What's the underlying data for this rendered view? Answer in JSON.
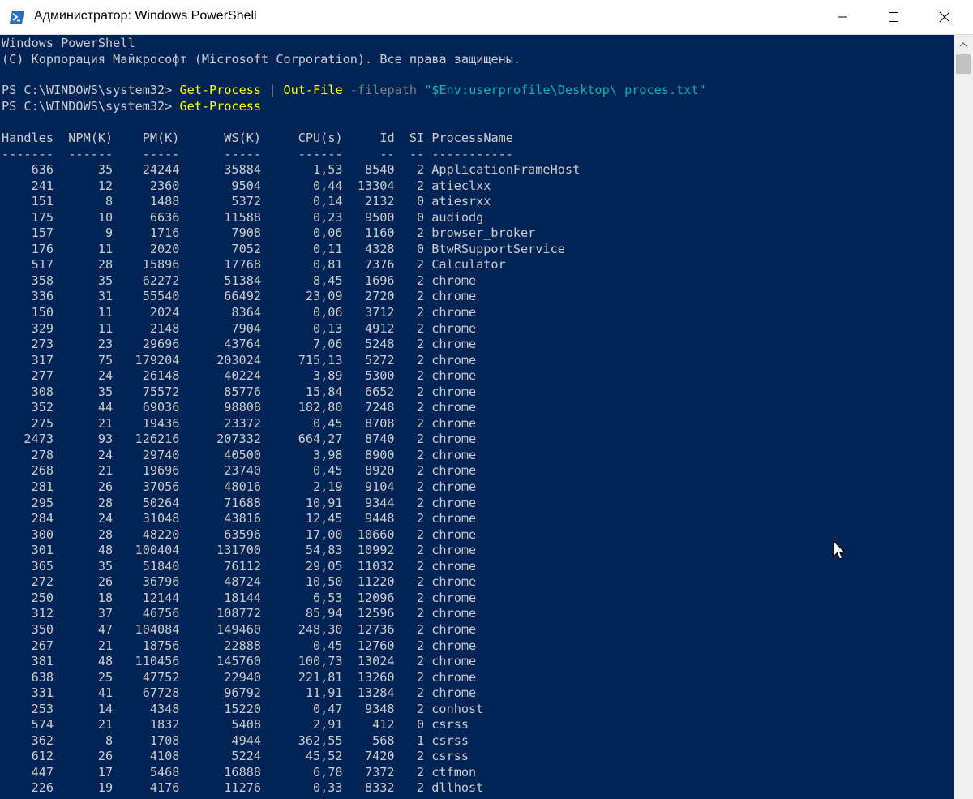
{
  "window": {
    "title": "Администратор: Windows PowerShell",
    "controls": [
      "minimize-icon",
      "maximize-icon",
      "close-icon"
    ],
    "colors": {
      "background": "#012456",
      "text": "#cccccc",
      "command": "#ffff00",
      "parameter": "#808080",
      "string": "#00b4b4"
    }
  },
  "console": {
    "header_line1": "Windows PowerShell",
    "header_line2": "(C) Корпорация Майкрософт (Microsoft Corporation). Все права защищены.",
    "cmd1": {
      "prompt": "PS C:\\WINDOWS\\system32> ",
      "command": "Get-Process",
      "pipe": " | ",
      "command2": "Out-File",
      "param": " -filepath ",
      "path": "\"$Env:userprofile\\Desktop\\ proces.txt\""
    },
    "cmd2": {
      "prompt": "PS C:\\WINDOWS\\system32> ",
      "command": "Get-Process"
    },
    "table_header": "Handles  NPM(K)    PM(K)      WS(K)     CPU(s)     Id  SI ProcessName",
    "table_separator": "-------  ------    -----      -----     ------     --  -- -----------",
    "rows": [
      [
        "636",
        "35",
        "24244",
        "35884",
        "1,53",
        "8540",
        "2",
        "ApplicationFrameHost"
      ],
      [
        "241",
        "12",
        "2360",
        "9504",
        "0,44",
        "13304",
        "2",
        "atieclxx"
      ],
      [
        "151",
        "8",
        "1488",
        "5372",
        "0,14",
        "2132",
        "0",
        "atiesrxx"
      ],
      [
        "175",
        "10",
        "6636",
        "11588",
        "0,23",
        "9500",
        "0",
        "audiodg"
      ],
      [
        "157",
        "9",
        "1716",
        "7908",
        "0,06",
        "1160",
        "2",
        "browser_broker"
      ],
      [
        "176",
        "11",
        "2020",
        "7052",
        "0,11",
        "4328",
        "0",
        "BtwRSupportService"
      ],
      [
        "517",
        "28",
        "15896",
        "17768",
        "0,81",
        "7376",
        "2",
        "Calculator"
      ],
      [
        "358",
        "35",
        "62272",
        "51384",
        "8,45",
        "1696",
        "2",
        "chrome"
      ],
      [
        "336",
        "31",
        "55540",
        "66492",
        "23,09",
        "2720",
        "2",
        "chrome"
      ],
      [
        "150",
        "11",
        "2024",
        "8364",
        "0,06",
        "3712",
        "2",
        "chrome"
      ],
      [
        "329",
        "11",
        "2148",
        "7904",
        "0,13",
        "4912",
        "2",
        "chrome"
      ],
      [
        "273",
        "23",
        "29696",
        "43764",
        "7,06",
        "5248",
        "2",
        "chrome"
      ],
      [
        "317",
        "75",
        "179204",
        "203024",
        "715,13",
        "5272",
        "2",
        "chrome"
      ],
      [
        "277",
        "24",
        "26148",
        "40224",
        "3,89",
        "5300",
        "2",
        "chrome"
      ],
      [
        "308",
        "35",
        "75572",
        "85776",
        "15,84",
        "6652",
        "2",
        "chrome"
      ],
      [
        "352",
        "44",
        "69036",
        "98808",
        "182,80",
        "7248",
        "2",
        "chrome"
      ],
      [
        "275",
        "21",
        "19436",
        "23372",
        "0,45",
        "8708",
        "2",
        "chrome"
      ],
      [
        "2473",
        "93",
        "126216",
        "207332",
        "664,27",
        "8740",
        "2",
        "chrome"
      ],
      [
        "278",
        "24",
        "29740",
        "40500",
        "3,98",
        "8900",
        "2",
        "chrome"
      ],
      [
        "268",
        "21",
        "19696",
        "23740",
        "0,45",
        "8920",
        "2",
        "chrome"
      ],
      [
        "281",
        "26",
        "37056",
        "48016",
        "2,19",
        "9104",
        "2",
        "chrome"
      ],
      [
        "295",
        "28",
        "50264",
        "71688",
        "10,91",
        "9344",
        "2",
        "chrome"
      ],
      [
        "284",
        "24",
        "31048",
        "43816",
        "12,45",
        "9448",
        "2",
        "chrome"
      ],
      [
        "300",
        "28",
        "48220",
        "63596",
        "17,00",
        "10660",
        "2",
        "chrome"
      ],
      [
        "301",
        "48",
        "100404",
        "131700",
        "54,83",
        "10992",
        "2",
        "chrome"
      ],
      [
        "365",
        "35",
        "51840",
        "76112",
        "29,05",
        "11032",
        "2",
        "chrome"
      ],
      [
        "272",
        "26",
        "36796",
        "48724",
        "10,50",
        "11220",
        "2",
        "chrome"
      ],
      [
        "250",
        "18",
        "12144",
        "18144",
        "6,53",
        "12096",
        "2",
        "chrome"
      ],
      [
        "312",
        "37",
        "46756",
        "108772",
        "85,94",
        "12596",
        "2",
        "chrome"
      ],
      [
        "350",
        "47",
        "104084",
        "149460",
        "248,30",
        "12736",
        "2",
        "chrome"
      ],
      [
        "267",
        "21",
        "18756",
        "22888",
        "0,45",
        "12760",
        "2",
        "chrome"
      ],
      [
        "381",
        "48",
        "110456",
        "145760",
        "100,73",
        "13024",
        "2",
        "chrome"
      ],
      [
        "638",
        "25",
        "47752",
        "22940",
        "221,81",
        "13260",
        "2",
        "chrome"
      ],
      [
        "331",
        "41",
        "67728",
        "96792",
        "11,91",
        "13284",
        "2",
        "chrome"
      ],
      [
        "253",
        "14",
        "4348",
        "15220",
        "0,47",
        "9348",
        "2",
        "conhost"
      ],
      [
        "574",
        "21",
        "1832",
        "5408",
        "2,91",
        "412",
        "0",
        "csrss"
      ],
      [
        "362",
        "8",
        "1708",
        "4944",
        "362,55",
        "568",
        "1",
        "csrss"
      ],
      [
        "612",
        "26",
        "4108",
        "5224",
        "45,52",
        "7420",
        "2",
        "csrss"
      ],
      [
        "447",
        "17",
        "5468",
        "16888",
        "6,78",
        "7372",
        "2",
        "ctfmon"
      ],
      [
        "226",
        "19",
        "4176",
        "11276",
        "0,33",
        "8332",
        "2",
        "dllhost"
      ]
    ]
  }
}
